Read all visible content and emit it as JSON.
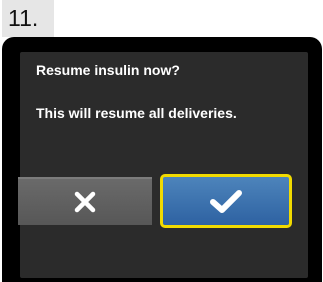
{
  "step": {
    "label": "11."
  },
  "dialog": {
    "title": "Resume insulin now?",
    "message": "This will resume all deliveries."
  },
  "buttons": {
    "cancel": {
      "icon": "close-icon",
      "color": "#ffffff"
    },
    "confirm": {
      "icon": "checkmark-icon",
      "color": "#ffffff",
      "highlight": "#f1da00"
    }
  }
}
